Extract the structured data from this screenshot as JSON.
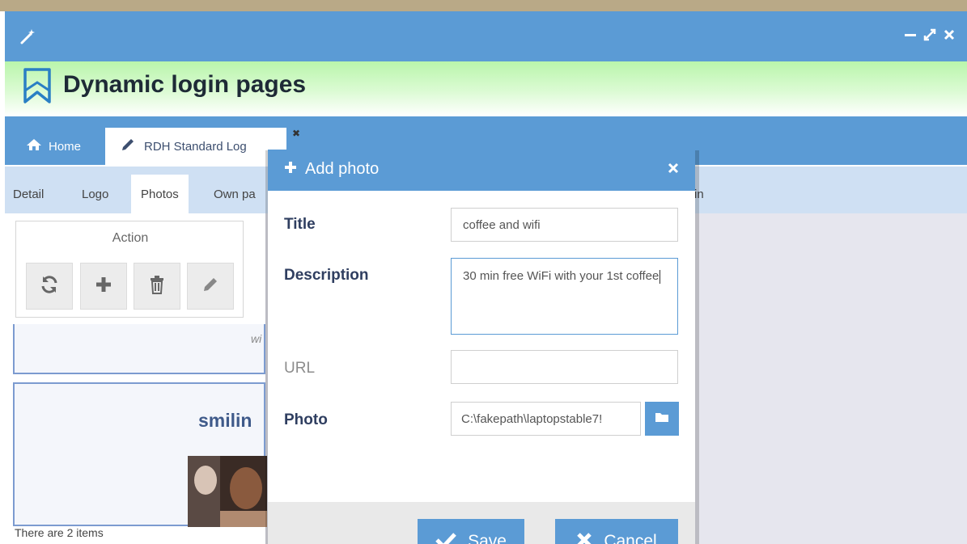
{
  "header": {
    "title": "Dynamic login pages"
  },
  "tabs": {
    "home_label": "Home",
    "document_label": "RDH Standard Log"
  },
  "subtabs": {
    "items": [
      "Detail",
      "Logo",
      "Photos",
      "Own pa"
    ],
    "active": "Photos",
    "right_fragment": "in"
  },
  "action_panel": {
    "label": "Action",
    "buttons": [
      "refresh-icon",
      "plus-icon",
      "trash-icon",
      "pencil-icon"
    ]
  },
  "list": {
    "card1_fragment": "wi",
    "card2_title_fragment": "smilin",
    "items_count": "There are 2 items"
  },
  "modal": {
    "title": "Add photo",
    "fields": {
      "title_label": "Title",
      "title_value": "coffee and wifi",
      "description_label": "Description",
      "description_value": "30 min free WiFi with your 1st coffee",
      "url_label": "URL",
      "url_value": "",
      "photo_label": "Photo",
      "photo_value": "C:\\fakepath\\laptopstable7!"
    },
    "save_label": "Save",
    "cancel_label": "Cancel"
  },
  "colors": {
    "accent": "#5b9bd5",
    "header_gradient": "#b9f5ab",
    "subtab_bar": "#cfe0f3",
    "label_text": "#2f3e60"
  }
}
